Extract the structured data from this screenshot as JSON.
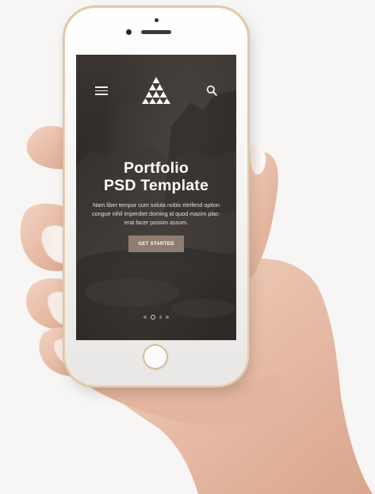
{
  "hero": {
    "title_line1": "Portfolio",
    "title_line2": "PSD Template",
    "text_line1": "Nam liber tempor cum soluta nobis eleifend option",
    "text_line2": "congue nihil imperdiet doming id quod mazim plac-",
    "text_line3": "erat facer possim assum.",
    "cta_label": "GET STARTED"
  },
  "navbar": {
    "menu_icon": "hamburger-menu-icon",
    "logo_icon": "triangle-logo-icon",
    "search_icon": "search-icon"
  },
  "slider": {
    "total": 4,
    "active_index": 1
  },
  "colors": {
    "cta_background": "#8f7d71",
    "phone_trim": "#d8bc98",
    "screen_background": "#322e2b"
  }
}
